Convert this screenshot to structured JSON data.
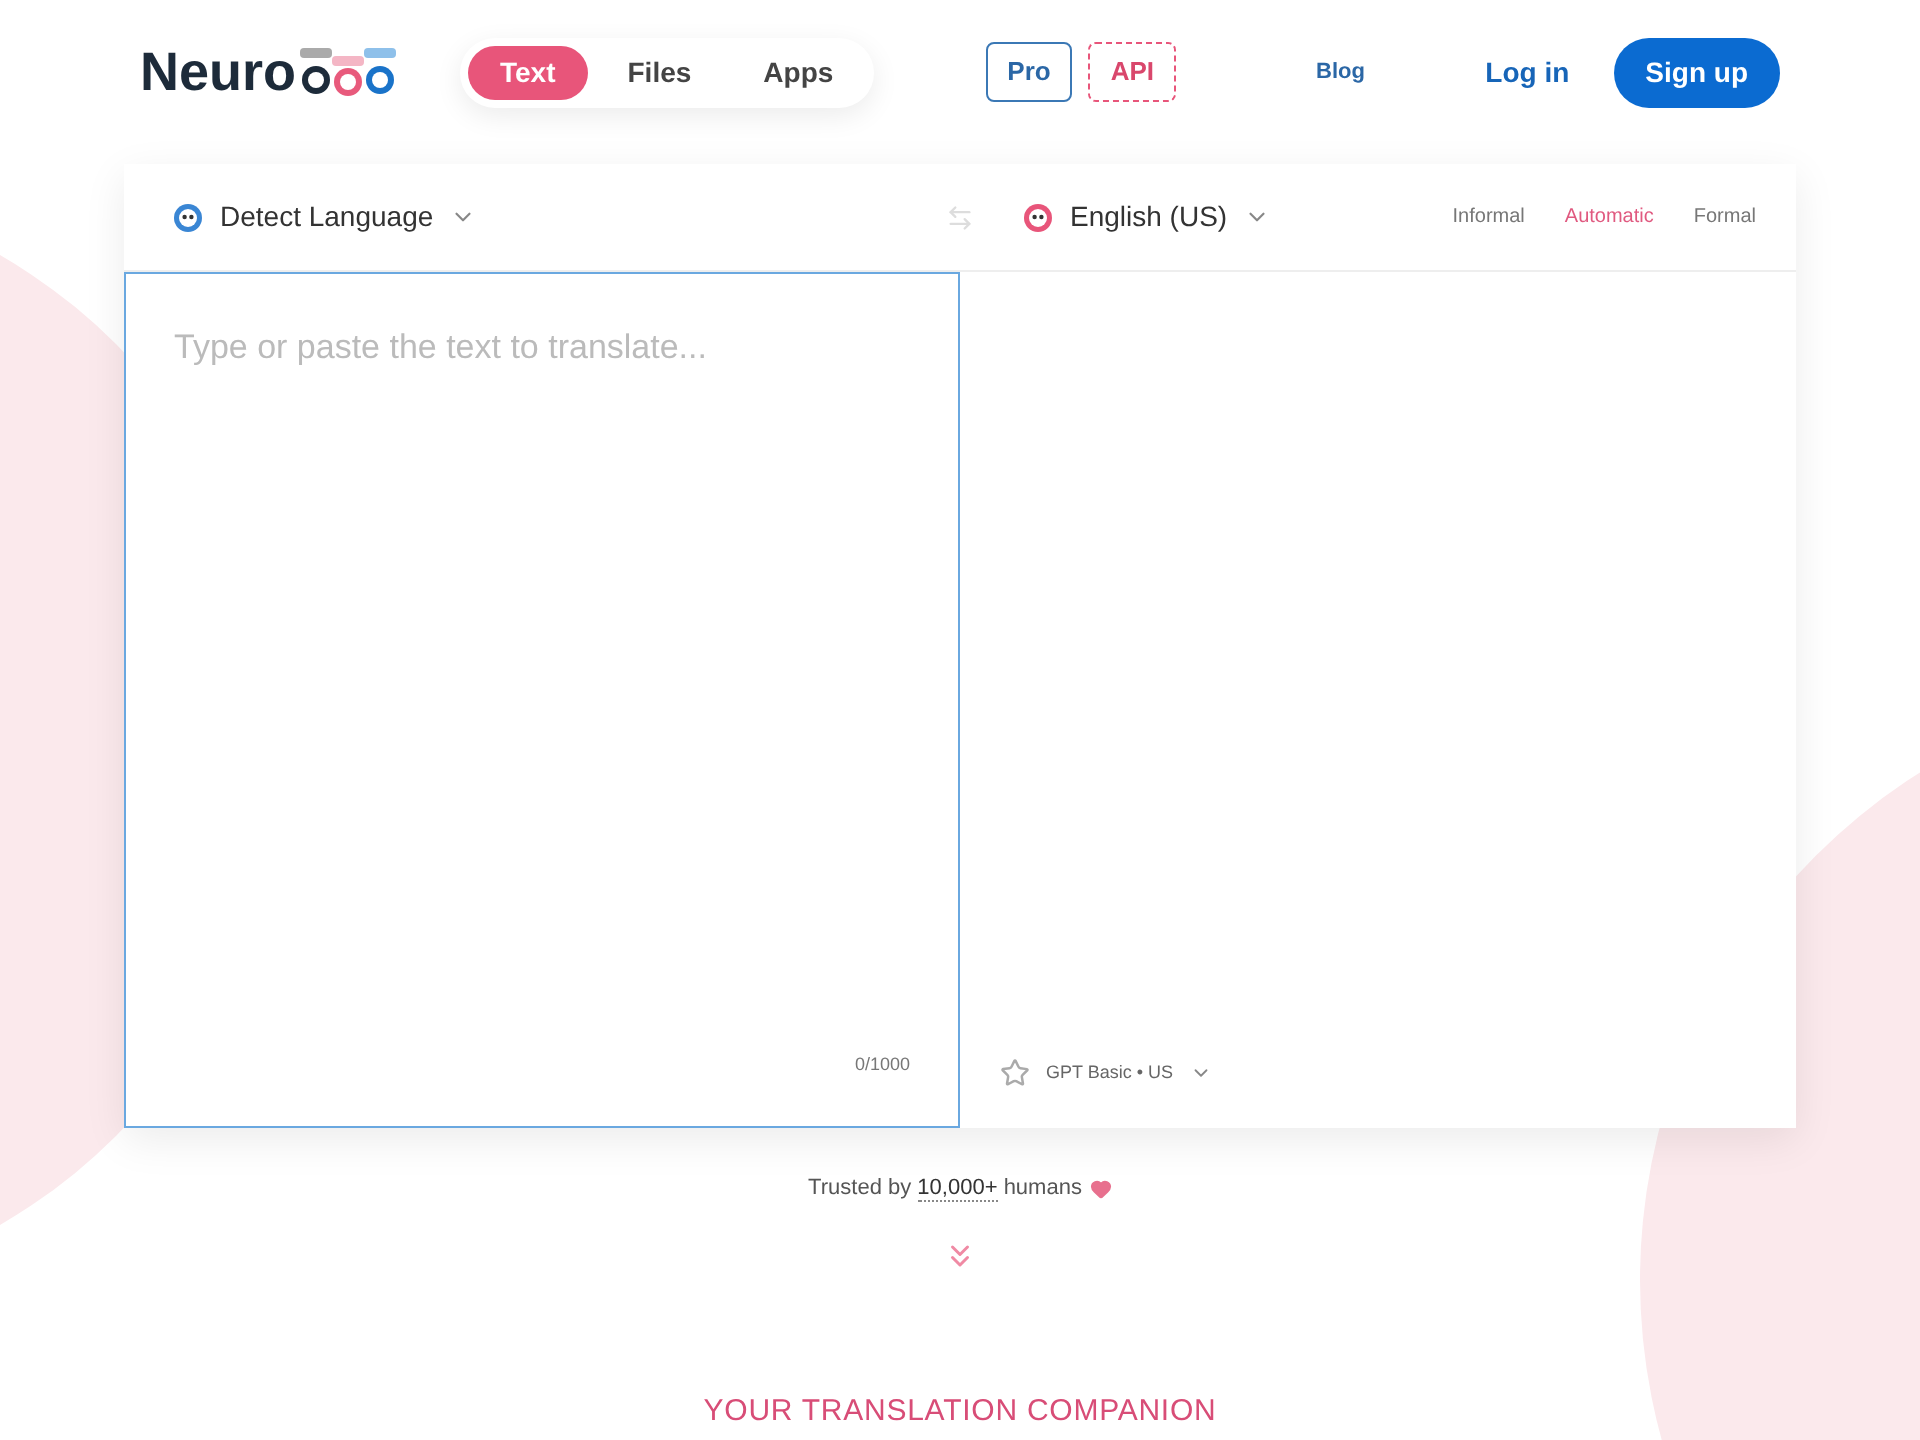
{
  "header": {
    "logo": "Neuro",
    "mode_tabs": [
      {
        "label": "Text",
        "selected": true
      },
      {
        "label": "Files",
        "selected": false
      },
      {
        "label": "Apps",
        "selected": false
      }
    ],
    "plan_links": [
      {
        "label": "Pro",
        "kind": "solid"
      },
      {
        "label": "API",
        "kind": "dashed"
      }
    ],
    "blog": "Blog",
    "login": "Log in",
    "signup": "Sign up"
  },
  "translator": {
    "source_language": "Detect Language",
    "target_language": "English (US)",
    "tones": [
      {
        "label": "Informal",
        "selected": false
      },
      {
        "label": "Automatic",
        "selected": true
      },
      {
        "label": "Formal",
        "selected": false
      }
    ],
    "input_placeholder": "Type or paste the text to translate...",
    "char_count": "0/1000",
    "model": "GPT Basic • US"
  },
  "trusted": {
    "prefix": "Trusted by",
    "count": "10,000+",
    "suffix": "humans"
  },
  "section_heading": "YOUR TRANSLATION COMPANION"
}
